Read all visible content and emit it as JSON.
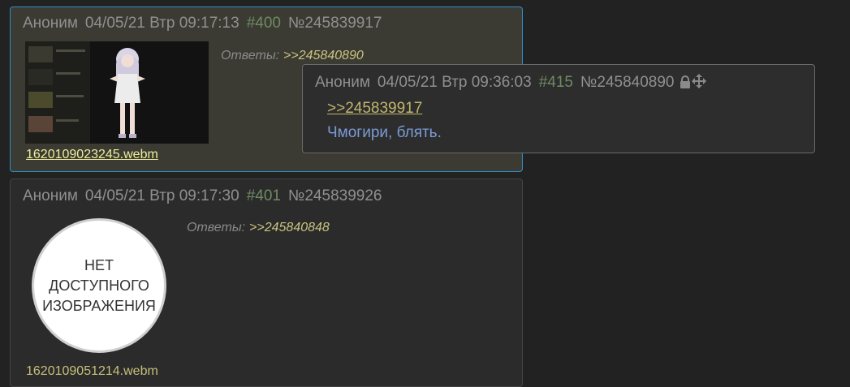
{
  "post1": {
    "author": "Аноним",
    "date": "04/05/21 Втр 09:17:13",
    "num": "#400",
    "post_id": "№245839917",
    "replies_label": "Ответы:",
    "reply_link": ">>245840890",
    "filename": "1620109023245.webm"
  },
  "post2": {
    "author": "Аноним",
    "date": "04/05/21 Втр 09:17:30",
    "num": "#401",
    "post_id": "№245839926",
    "replies_label": "Ответы:",
    "reply_link": ">>245840848",
    "no_image_text": "НЕТ ДОСТУПНОГО ИЗОБРАЖЕНИЯ",
    "filename": "1620109051214.webm"
  },
  "popup": {
    "author": "Аноним",
    "date": "04/05/21 Втр 09:36:03",
    "num": "#415",
    "post_id": "№245840890",
    "quote_link": ">>245839917",
    "text": "Чмогири, блять.",
    "icons": [
      "lock-icon",
      "move-icon"
    ]
  },
  "colors": {
    "highlight_bg": "#3b3b34",
    "highlight_border": "#2d8fc4",
    "post_bg": "#2b2b2b",
    "post_number": "#6f8b62",
    "link": "#c8c27e",
    "popup_text": "#7a9bd6"
  }
}
